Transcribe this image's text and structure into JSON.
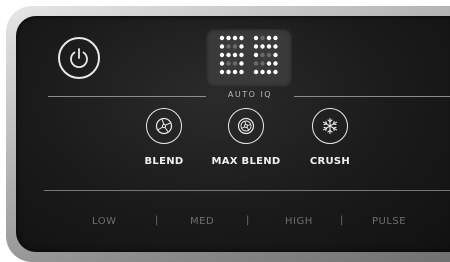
{
  "display": {
    "label": "AUTO IQ"
  },
  "programs": {
    "blend": "BLEND",
    "max_blend": "MAX BLEND",
    "crush": "CRUSH"
  },
  "speeds": {
    "low": "LOW",
    "med": "MED",
    "high": "HIGH",
    "pulse": "PULSE",
    "separator": "|"
  },
  "icons": {
    "power": "power-icon",
    "blend": "blend-icon",
    "max_blend": "max-blend-icon",
    "crush": "snowflake-icon"
  },
  "colors": {
    "panel": "#1a1a1a",
    "bezel": "#b9b9b9",
    "text_active": "#f0f0f0",
    "text_dim": "#6e6e6e",
    "led_on": "#ffffff",
    "led_off": "#6a6a6a"
  }
}
